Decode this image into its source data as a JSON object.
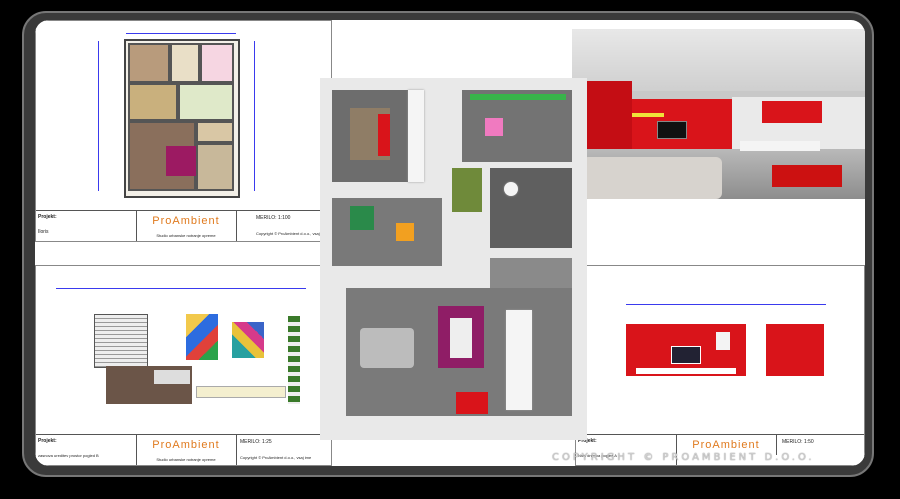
{
  "sheet_tl": {
    "projekt_label": "Projekt:",
    "line2": "Iloris",
    "logo": "ProAmbient",
    "sub": "Studio urbanske notranje opreme",
    "scale": "MERILO: 1:100",
    "copyright": "Copyright © ProAmbient d.o.o., vsaj ime"
  },
  "sheet_bl": {
    "projekt_label": "Projekt:",
    "line2": "zasnova ureditev prostor pogled B",
    "logo": "ProAmbient",
    "sub": "Studio urbanske notranje opreme",
    "scale": "MERILO: 1:25",
    "copyright": "Copyright © ProAmbient d.o.o., vsaj ime"
  },
  "sheet_br": {
    "projekt_label": "Projekt:",
    "line2": "Nivo dnevna pogled A",
    "logo": "ProAmbient",
    "scale": "MERILO: 1:50"
  },
  "watermark": "COPYRIGHT © PROAMBIENT D.O.O.",
  "colors": {
    "accent_red": "#d9141a",
    "logo_orange": "#e07a1e",
    "dim_blue": "#3a3aee"
  }
}
